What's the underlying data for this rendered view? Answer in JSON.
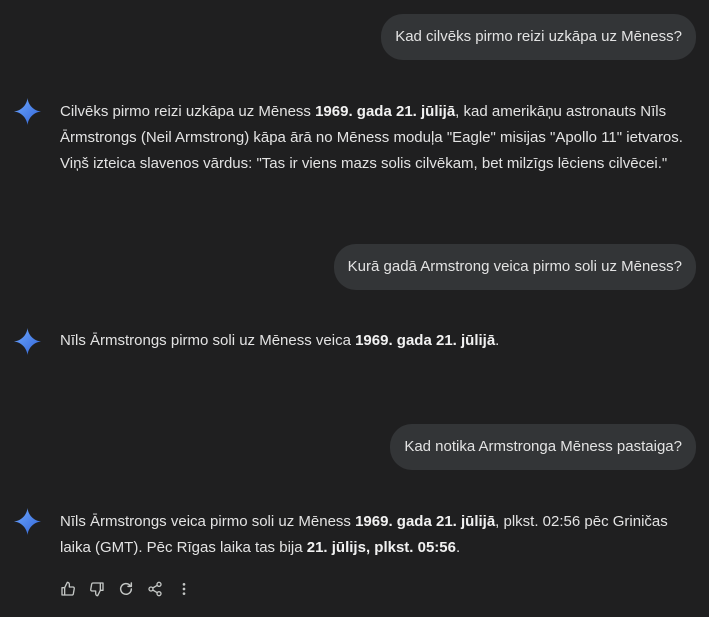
{
  "conversation": {
    "turn1": {
      "user": "Kad cilvēks pirmo reizi uzkāpa uz Mēness?",
      "answer": {
        "p1": "Cilvēks pirmo reizi uzkāpa uz Mēness ",
        "b1": "1969. gada 21. jūlijā",
        "p2": ", kad amerikāņu astronauts Nīls Ārmstrongs (Neil Armstrong) kāpa ārā no Mēness moduļa \"Eagle\" misijas \"Apollo 11\" ietvaros. Viņš izteica slavenos vārdus: \"Tas ir viens mazs solis cilvēkam, bet milzīgs lēciens cilvēcei.\""
      }
    },
    "turn2": {
      "user": "Kurā gadā Armstrong veica pirmo soli uz Mēness?",
      "answer": {
        "p1": "Nīls Ārmstrongs pirmo soli uz Mēness veica ",
        "b1": "1969. gada 21. jūlijā",
        "p2": "."
      }
    },
    "turn3": {
      "user": "Kad notika Armstronga Mēness pastaiga?",
      "answer": {
        "p1": "Nīls Ārmstrongs veica pirmo soli uz Mēness ",
        "b1": "1969. gada 21. jūlijā",
        "p2": ", plkst. 02:56 pēc Griničas laika (GMT). Pēc Rīgas laika tas bija ",
        "b2": "21. jūlijs, plkst. 05:56",
        "p3": "."
      }
    }
  },
  "actions": {
    "icons": [
      "thumbs-up-icon",
      "thumbs-down-icon",
      "regenerate-icon",
      "share-icon",
      "more-vert-icon"
    ]
  },
  "colors": {
    "background": "#1f1f20",
    "user_bubble": "#333537",
    "text": "#e3e3e3",
    "sparkle_top": "#4f8df7",
    "sparkle_bottom": "#3a6fe0"
  }
}
